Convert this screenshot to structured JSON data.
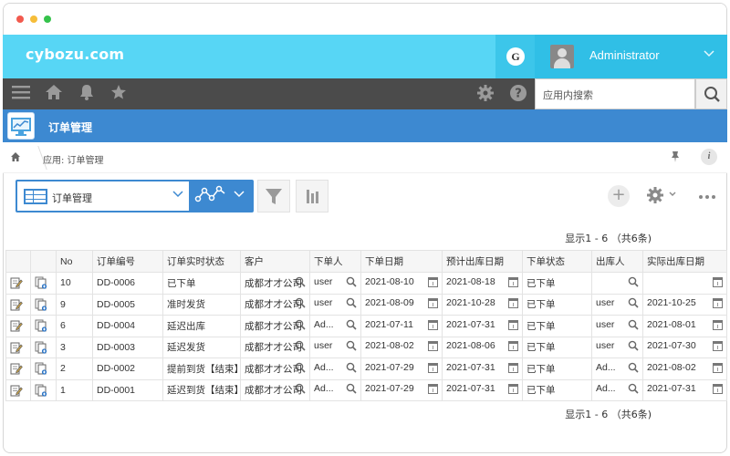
{
  "window": {
    "dot_colors": [
      "#f25a4e",
      "#f6bd39",
      "#35c24b"
    ]
  },
  "brand": {
    "name": "cybozu.com",
    "bar_color": "#57d6f5"
  },
  "account": {
    "service_initial": "G",
    "username": "Administrator"
  },
  "toolbar": {
    "icons": [
      "menu-icon",
      "home-icon",
      "bell-icon",
      "star-icon",
      "gear-icon",
      "help-icon"
    ],
    "search_placeholder": "应用内搜索"
  },
  "app": {
    "title": "订单管理",
    "accent": "#3d89d1"
  },
  "breadcrumb": {
    "text": "应用: 订单管理"
  },
  "view": {
    "name": "订单管理"
  },
  "pager": {
    "top": "显示1 - 6 （共6条)",
    "bottom": "显示1 - 6 （共6条)"
  },
  "table": {
    "columns": [
      "No",
      "订单编号",
      "订单实时状态",
      "客户",
      "下单人",
      "下单日期",
      "预计出库日期",
      "下单状态",
      "出库人",
      "实际出库日期"
    ],
    "rows": [
      {
        "no": "10",
        "id": "DD-0006",
        "status": "已下单",
        "status_color": "red",
        "customer": "成都才才公司",
        "orderer": "user",
        "order_date": "2021-08-10",
        "eta": "2021-08-18",
        "order_state": "已下单",
        "shipper": "",
        "ship_date": ""
      },
      {
        "no": "9",
        "id": "DD-0005",
        "status": "准时发货",
        "status_color": "red",
        "customer": "成都才才公司",
        "orderer": "user",
        "order_date": "2021-08-09",
        "eta": "2021-10-28",
        "order_state": "已下单",
        "shipper": "user",
        "ship_date": "2021-10-25"
      },
      {
        "no": "6",
        "id": "DD-0004",
        "status": "延迟出库",
        "status_color": "red",
        "customer": "成都才才公司",
        "orderer": "Ad...",
        "order_date": "2021-07-11",
        "eta": "2021-07-31",
        "order_state": "已下单",
        "shipper": "user",
        "ship_date": "2021-08-01"
      },
      {
        "no": "3",
        "id": "DD-0003",
        "status": "延迟发货",
        "status_color": "red",
        "customer": "成都才才公司",
        "orderer": "user",
        "order_date": "2021-08-02",
        "eta": "2021-08-06",
        "order_state": "已下单",
        "shipper": "user",
        "ship_date": "2021-07-30"
      },
      {
        "no": "2",
        "id": "DD-0002",
        "status": "提前到货【结束】",
        "status_color": "blue",
        "customer": "成都才才公司",
        "orderer": "Ad...",
        "order_date": "2021-07-29",
        "eta": "2021-07-31",
        "order_state": "已下单",
        "shipper": "Ad...",
        "ship_date": "2021-08-02"
      },
      {
        "no": "1",
        "id": "DD-0001",
        "status": "延迟到货【结束】",
        "status_color": "blue",
        "customer": "成都才才公司",
        "orderer": "Ad...",
        "order_date": "2021-07-29",
        "eta": "2021-07-31",
        "order_state": "已下单",
        "shipper": "Ad...",
        "ship_date": "2021-07-31"
      }
    ]
  }
}
